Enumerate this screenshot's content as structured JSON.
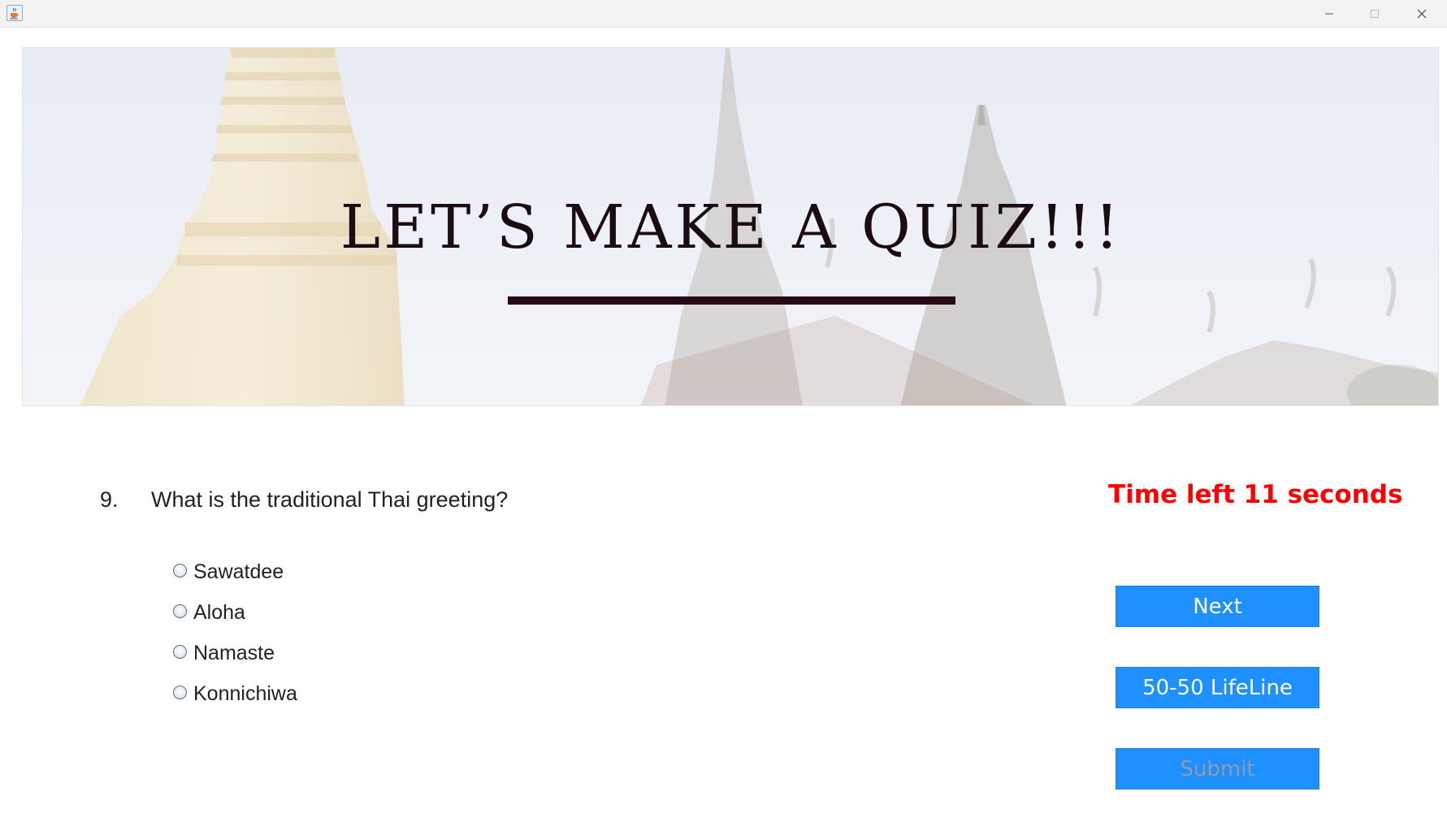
{
  "window": {
    "icons": {
      "app": "java-cup-icon",
      "minimize": "minimize-icon",
      "maximize": "maximize-icon",
      "close": "close-icon"
    }
  },
  "banner": {
    "title": "LET’S MAKE A QUIZ!!!",
    "image": "thai-temple-spires-background"
  },
  "question": {
    "number": "9.",
    "text": "What is the traditional Thai greeting?",
    "options": [
      {
        "label": "Sawatdee",
        "selected": false
      },
      {
        "label": "Aloha",
        "selected": false
      },
      {
        "label": "Namaste",
        "selected": false
      },
      {
        "label": "Konnichiwa",
        "selected": false
      }
    ]
  },
  "timer": {
    "text": "Time left 11 seconds",
    "color": "#ff0000"
  },
  "buttons": {
    "next": "Next",
    "lifeline": "50-50 LifeLine",
    "submit": "Submit",
    "submit_enabled": false
  },
  "colors": {
    "button_bg": "#1e90ff",
    "button_text": "#ffffff",
    "button_text_disabled": "#8a9cb0",
    "title_text": "#1b0c12",
    "title_rule": "#260913"
  }
}
